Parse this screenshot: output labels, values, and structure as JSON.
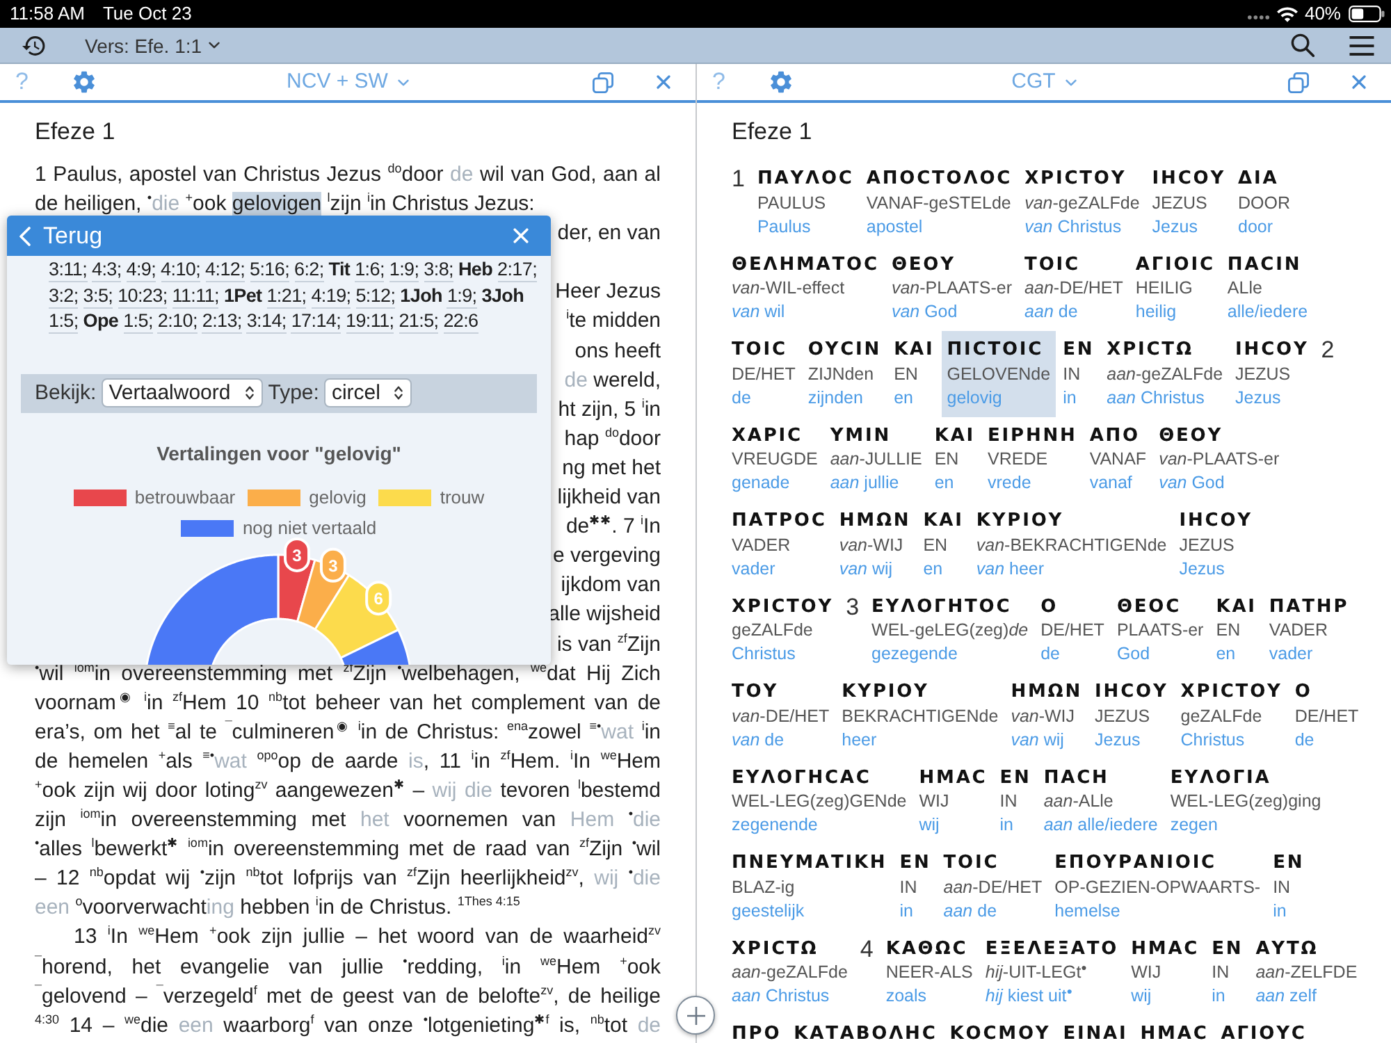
{
  "status_bar": {
    "time": "11:58 AM",
    "date": "Tue Oct 23",
    "battery": "40%"
  },
  "toolbar": {
    "verse_selector": "Vers: Efe. 1:1"
  },
  "panes": [
    {
      "kind": "text",
      "help": "?",
      "title": "NCV + SW",
      "heading": "Efeze 1",
      "lines": [
        {
          "kind": "justified",
          "segments": [
            {
              "kind": "plain",
              "text": "1 Paulus, apostel van Christus Jezus $^{do}$door "
            },
            {
              "kind": "muted",
              "text": "de"
            },
            {
              "kind": "plain",
              "text": " wil van God, aan al"
            }
          ]
        },
        {
          "kind": "end",
          "segments": [
            {
              "kind": "plain",
              "text": "de heiligen, $^{•}$"
            },
            {
              "kind": "muted",
              "text": "die"
            },
            {
              "kind": "plain",
              "text": " $^{+}$ook "
            },
            {
              "kind": "highlighted",
              "text": "gelovigen"
            },
            {
              "kind": "plain",
              "text": " $^{l}$zijn $^{i}$in Christus Jezus:"
            }
          ]
        },
        {
          "kind": "tail",
          "segments": [
            {
              "kind": "plain",
              "text": "der, en van"
            }
          ]
        },
        {
          "kind": "covered"
        },
        {
          "kind": "tail",
          "segments": [
            {
              "kind": "plain",
              "text": "Heer Jezus"
            }
          ]
        },
        {
          "kind": "tail",
          "segments": [
            {
              "kind": "plain",
              "text": "$^{i}$te midden"
            }
          ]
        },
        {
          "kind": "tail",
          "segments": [
            {
              "kind": "plain",
              "text": "ons heeft"
            }
          ]
        },
        {
          "kind": "tail",
          "segments": [
            {
              "kind": "muted",
              "text": "de"
            },
            {
              "kind": "plain",
              "text": " wereld,"
            }
          ]
        },
        {
          "kind": "tail",
          "segments": [
            {
              "kind": "plain",
              "text": "ht zijn, 5 $^{i}$in"
            }
          ]
        },
        {
          "kind": "tail",
          "segments": [
            {
              "kind": "plain",
              "text": "hap $^{do}$door"
            }
          ]
        },
        {
          "kind": "tail",
          "segments": [
            {
              "kind": "plain",
              "text": "ng met het"
            }
          ]
        },
        {
          "kind": "tail",
          "segments": [
            {
              "kind": "plain",
              "text": "lijkheid van"
            }
          ]
        },
        {
          "kind": "tail",
          "segments": [
            {
              "kind": "plain",
              "text": "de$^{✱✱}$. 7 $^{i}$In"
            }
          ]
        },
        {
          "kind": "tail",
          "segments": [
            {
              "kind": "plain",
              "text": "e vergeving"
            }
          ]
        },
        {
          "kind": "tail",
          "segments": [
            {
              "kind": "plain",
              "text": "ijkdom van"
            }
          ]
        },
        {
          "kind": "tail",
          "segments": [
            {
              "kind": "plain",
              "text": "alle wijsheid"
            }
          ]
        },
        {
          "kind": "tail",
          "segments": [
            {
              "kind": "plain",
              "text": "is van $^{zf}$Zijn"
            }
          ]
        },
        {
          "kind": "justified",
          "segments": [
            {
              "kind": "plain",
              "text": "$^{•}$wil $^{iom}$in overeenstemming met $^{zf}$Zijn $^{•}$welbehagen, $^{we}$dat Hij Zich"
            }
          ]
        },
        {
          "kind": "justified",
          "segments": [
            {
              "kind": "plain",
              "text": "voornam$^{◉}$ $^{i}$in $^{zf}$Hem 10 $^{nb}$tot beheer van het complement van de"
            }
          ]
        },
        {
          "kind": "justified",
          "segments": [
            {
              "kind": "plain",
              "text": "era’s, om het $^{≡}$al te $^{¯}$culmineren$^{◉}$ $^{i}$in de Christus: $^{ena}$zowel $^{≡•}$"
            },
            {
              "kind": "muted",
              "text": "wat"
            },
            {
              "kind": "plain",
              "text": " $^{i}$in"
            }
          ]
        },
        {
          "kind": "justified",
          "segments": [
            {
              "kind": "plain",
              "text": "de hemelen $^{+}$als $^{≡•}$"
            },
            {
              "kind": "muted",
              "text": "wat"
            },
            {
              "kind": "plain",
              "text": " $^{opo}$op de aarde "
            },
            {
              "kind": "muted",
              "text": "is"
            },
            {
              "kind": "plain",
              "text": ", 11 $^{i}$in $^{zf}$Hem. $^{i}$In $^{we}$Hem"
            }
          ]
        },
        {
          "kind": "justified",
          "segments": [
            {
              "kind": "plain",
              "text": "$^{+}$ook zijn wij door loting$^{zv}$ aangewezen$^{✱}$ – "
            },
            {
              "kind": "muted",
              "text": "wij die"
            },
            {
              "kind": "plain",
              "text": " tevoren $^{l}$bestemd"
            }
          ]
        },
        {
          "kind": "justified",
          "segments": [
            {
              "kind": "plain",
              "text": "zijn $^{iom}$in overeenstemming met "
            },
            {
              "kind": "muted",
              "text": "het"
            },
            {
              "kind": "plain",
              "text": " voornemen van "
            },
            {
              "kind": "muted",
              "text": "Hem"
            },
            {
              "kind": "plain",
              "text": " $^{•}$"
            },
            {
              "kind": "muted",
              "text": "die"
            }
          ]
        },
        {
          "kind": "justified",
          "segments": [
            {
              "kind": "plain",
              "text": "$^{•}$alles $^{l}$bewerkt$^{✱}$ $^{iom}$in overeenstemming met de raad van $^{zf}$Zijn $^{•}$wil"
            }
          ]
        },
        {
          "kind": "justified",
          "segments": [
            {
              "kind": "plain",
              "text": "– 12 $^{nb}$opdat wij $^{•}$zijn $^{nb}$tot lofprijs van $^{zf}$Zijn heerlijkheid$^{zv}$, "
            },
            {
              "kind": "muted",
              "text": "wij"
            },
            {
              "kind": "plain",
              "text": " $^{•}$"
            },
            {
              "kind": "muted",
              "text": "die"
            }
          ]
        },
        {
          "kind": "end",
          "segments": [
            {
              "kind": "muted",
              "text": "een"
            },
            {
              "kind": "plain",
              "text": " $^{o}$voorverwacht"
            },
            {
              "kind": "muted",
              "text": "ing"
            },
            {
              "kind": "plain",
              "text": " hebben $^{i}$in de Christus. $^{1Thes 4:15}$"
            }
          ]
        },
        {
          "kind": "indented",
          "segments": [
            {
              "kind": "plain",
              "text": "13 $^{i}$In $^{we}$Hem $^{+}$ook zijn jullie – het woord van de waarheid$^{zv}$"
            }
          ]
        },
        {
          "kind": "justified",
          "segments": [
            {
              "kind": "plain",
              "text": "$^{¯}$horend, het evangelie van jullie $^{•}$redding, $^{i}$in $^{we}$Hem $^{+}$ook"
            }
          ]
        },
        {
          "kind": "justified",
          "segments": [
            {
              "kind": "plain",
              "text": "$^{¯}$gelovend – $^{¯}$verzegeld$^{f}$ met de geest van de belofte$^{zv}$, de heilige"
            }
          ]
        },
        {
          "kind": "justified",
          "segments": [
            {
              "kind": "plain",
              "text": "$^{4:30}$ 14 – $^{we}$die "
            },
            {
              "kind": "muted",
              "text": "een"
            },
            {
              "kind": "plain",
              "text": " waarborg$^{f}$ van onze $^{•}$lotgenieting$^{✱f}$ is, $^{nb}$tot "
            },
            {
              "kind": "muted",
              "text": "de"
            }
          ]
        }
      ]
    },
    {
      "kind": "interlinear",
      "help": "?",
      "title": "CGT",
      "heading": "Efeze 1",
      "rows": [
        {
          "items": [
            {
              "kind": "verse",
              "number": "1"
            },
            {
              "kind": "word",
              "greek": "ΠΑΥΛΟϹ",
              "gloss": "PAULUS",
              "translation": "Paulus",
              "selected": false
            },
            {
              "kind": "word",
              "greek": "ΑΠΟϹΤΟΛΟϹ",
              "gloss": "VANAF-geSTELde",
              "translation": "apostel",
              "selected": false
            },
            {
              "kind": "word",
              "greek": "ΧΡΙϹΤΟΥ",
              "gloss": "*van*-geZALFde",
              "translation": "*van* Christus",
              "selected": false
            },
            {
              "kind": "word",
              "greek": "ΙΗϹΟΥ",
              "gloss": "JEZUS",
              "translation": "Jezus",
              "selected": false
            },
            {
              "kind": "word",
              "greek": "ΔΙΑ",
              "gloss": "DOOR",
              "translation": "door",
              "selected": false
            }
          ]
        },
        {
          "items": [
            {
              "kind": "word",
              "greek": "ΘΕΛΗΜΑΤΟϹ",
              "gloss": "*van*-WIL-effect",
              "translation": "*van* wil",
              "selected": false
            },
            {
              "kind": "word",
              "greek": "ΘΕΟΥ",
              "gloss": "*van*-PLAATS-er",
              "translation": "*van* God",
              "selected": false
            },
            {
              "kind": "word",
              "greek": "ΤΟΙϹ",
              "gloss": "*aan*-DE/HET",
              "translation": "*aan* de",
              "selected": false
            },
            {
              "kind": "word",
              "greek": "ΑΓΙΟΙϹ",
              "gloss": "HEILIG",
              "translation": "heilig",
              "selected": false
            },
            {
              "kind": "word",
              "greek": "ΠΑϹΙΝ",
              "gloss": "ALle",
              "translation": "alle/iedere",
              "selected": false
            }
          ]
        },
        {
          "items": [
            {
              "kind": "word",
              "greek": "ΤΟΙϹ",
              "gloss": "DE/HET",
              "translation": "de",
              "selected": false
            },
            {
              "kind": "word",
              "greek": "ΟΥϹΙΝ",
              "gloss": "ZIJNden",
              "translation": "zijnden",
              "selected": false
            },
            {
              "kind": "word",
              "greek": "ΚΑΙ",
              "gloss": "EN",
              "translation": "en",
              "selected": false
            },
            {
              "kind": "word",
              "greek": "ΠΙϹΤΟΙϹ",
              "gloss": "GELOVENde",
              "translation": "gelovig",
              "selected": true
            },
            {
              "kind": "word",
              "greek": "ΕΝ",
              "gloss": "IN",
              "translation": "in",
              "selected": false
            },
            {
              "kind": "word",
              "greek": "ΧΡΙϹΤΩ",
              "gloss": "*aan*-geZALFde",
              "translation": "*aan* Christus",
              "selected": false
            },
            {
              "kind": "word",
              "greek": "ΙΗϹΟΥ",
              "gloss": "JEZUS",
              "translation": "Jezus",
              "selected": false
            },
            {
              "kind": "verse",
              "number": "2"
            }
          ]
        },
        {
          "items": [
            {
              "kind": "word",
              "greek": "ΧΑΡΙϹ",
              "gloss": "VREUGDE",
              "translation": "genade",
              "selected": false
            },
            {
              "kind": "word",
              "greek": "ΥΜΙΝ",
              "gloss": "*aan*-JULLIE",
              "translation": "*aan* jullie",
              "selected": false
            },
            {
              "kind": "word",
              "greek": "ΚΑΙ",
              "gloss": "EN",
              "translation": "en",
              "selected": false
            },
            {
              "kind": "word",
              "greek": "ΕΙΡΗΝΗ",
              "gloss": "VREDE",
              "translation": "vrede",
              "selected": false
            },
            {
              "kind": "word",
              "greek": "ΑΠΟ",
              "gloss": "VANAF",
              "translation": "vanaf",
              "selected": false
            },
            {
              "kind": "word",
              "greek": "ΘΕΟΥ",
              "gloss": "*van*-PLAATS-er",
              "translation": "*van* God",
              "selected": false
            }
          ]
        },
        {
          "items": [
            {
              "kind": "word",
              "greek": "ΠΑΤΡΟϹ",
              "gloss": "VADER",
              "translation": "vader",
              "selected": false
            },
            {
              "kind": "word",
              "greek": "ΗΜΩΝ",
              "gloss": "*van*-WIJ",
              "translation": "*van* wij",
              "selected": false
            },
            {
              "kind": "word",
              "greek": "ΚΑΙ",
              "gloss": "EN",
              "translation": "en",
              "selected": false
            },
            {
              "kind": "word",
              "greek": "ΚΥΡΙΟΥ",
              "gloss": "*van*-BEKRACHTIGENde",
              "translation": "*van* heer",
              "selected": false
            },
            {
              "kind": "word",
              "greek": "ΙΗϹΟΥ",
              "gloss": "JEZUS",
              "translation": "Jezus",
              "selected": false
            }
          ]
        },
        {
          "items": [
            {
              "kind": "word",
              "greek": "ΧΡΙϹΤΟΥ",
              "gloss": "geZALFde",
              "translation": "Christus",
              "selected": false
            },
            {
              "kind": "verse",
              "number": "3"
            },
            {
              "kind": "word",
              "greek": "ΕΥΛΟΓΗΤΟϹ",
              "gloss": "WEL-geLEG(zeg)*de*",
              "translation": "gezegende",
              "selected": false
            },
            {
              "kind": "word",
              "greek": "Ο",
              "gloss": "DE/HET",
              "translation": "de",
              "selected": false
            },
            {
              "kind": "word",
              "greek": "ΘΕΟϹ",
              "gloss": "PLAATS-er",
              "translation": "God",
              "selected": false
            },
            {
              "kind": "word",
              "greek": "ΚΑΙ",
              "gloss": "EN",
              "translation": "en",
              "selected": false
            },
            {
              "kind": "word",
              "greek": "ΠΑΤΗΡ",
              "gloss": "VADER",
              "translation": "vader",
              "selected": false
            }
          ]
        },
        {
          "items": [
            {
              "kind": "word",
              "greek": "ΤΟΥ",
              "gloss": "*van*-DE/HET",
              "translation": "*van* de",
              "selected": false
            },
            {
              "kind": "word",
              "greek": "ΚΥΡΙΟΥ",
              "gloss": "BEKRACHTIGENde",
              "translation": "heer",
              "selected": false
            },
            {
              "kind": "word",
              "greek": "ΗΜΩΝ",
              "gloss": "*van*-WIJ",
              "translation": "*van* wij",
              "selected": false
            },
            {
              "kind": "word",
              "greek": "ΙΗϹΟΥ",
              "gloss": "JEZUS",
              "translation": "Jezus",
              "selected": false
            },
            {
              "kind": "word",
              "greek": "ΧΡΙϹΤΟΥ",
              "gloss": "geZALFde",
              "translation": "Christus",
              "selected": false
            },
            {
              "kind": "word",
              "greek": "Ο",
              "gloss": "DE/HET",
              "translation": "de",
              "selected": false
            }
          ]
        },
        {
          "items": [
            {
              "kind": "word",
              "greek": "ΕΥΛΟΓΗϹΑϹ",
              "gloss": "WEL-LEG(zeg)GENde",
              "translation": "zegenende",
              "selected": false
            },
            {
              "kind": "word",
              "greek": "ΗΜΑϹ",
              "gloss": "WIJ",
              "translation": "wij",
              "selected": false
            },
            {
              "kind": "word",
              "greek": "ΕΝ",
              "gloss": "IN",
              "translation": "in",
              "selected": false
            },
            {
              "kind": "word",
              "greek": "ΠΑϹΗ",
              "gloss": "*aan*-ALle",
              "translation": "*aan* alle/iedere",
              "selected": false
            },
            {
              "kind": "word",
              "greek": "ΕΥΛΟΓΙΑ",
              "gloss": "WEL-LEG(zeg)ging",
              "translation": "zegen",
              "selected": false
            }
          ]
        },
        {
          "items": [
            {
              "kind": "word",
              "greek": "ΠΝΕΥΜΑΤΙΚΗ",
              "gloss": "BLAZ-ig",
              "translation": "geestelijk",
              "selected": false
            },
            {
              "kind": "word",
              "greek": "ΕΝ",
              "gloss": "IN",
              "translation": "in",
              "selected": false
            },
            {
              "kind": "word",
              "greek": "ΤΟΙϹ",
              "gloss": "*aan*-DE/HET",
              "translation": "*aan* de",
              "selected": false
            },
            {
              "kind": "word",
              "greek": "ΕΠΟΥΡΑΝΙΟΙϹ",
              "gloss": "OP-GEZIEN-OPWAARTS-",
              "translation": "hemelse",
              "selected": false
            },
            {
              "kind": "word",
              "greek": "ΕΝ",
              "gloss": "IN",
              "translation": "in",
              "selected": false
            }
          ]
        },
        {
          "items": [
            {
              "kind": "word",
              "greek": "ΧΡΙϹΤΩ",
              "gloss": "*aan*-geZALFde",
              "translation": "*aan* Christus",
              "selected": false
            },
            {
              "kind": "verse",
              "number": "4"
            },
            {
              "kind": "word",
              "greek": "ΚΑΘΩϹ",
              "gloss": "NEER-ALS",
              "translation": "zoals",
              "selected": false
            },
            {
              "kind": "word",
              "greek": "ΕΞΕΛΕΞΑΤΟ",
              "gloss": "*hij*-UIT-LEGt$^{●}$",
              "translation": "*hij* kiest uit$^{●}$",
              "selected": false
            },
            {
              "kind": "word",
              "greek": "ΗΜΑϹ",
              "gloss": "WIJ",
              "translation": "wij",
              "selected": false
            },
            {
              "kind": "word",
              "greek": "ΕΝ",
              "gloss": "IN",
              "translation": "in",
              "selected": false
            },
            {
              "kind": "word",
              "greek": "ΑΥΤΩ",
              "gloss": "*aan*-ZELFDE",
              "translation": "*aan* zelf",
              "selected": false
            }
          ]
        },
        {
          "items": [
            {
              "kind": "word",
              "greek": "ΠΡΟ",
              "selected": false
            },
            {
              "kind": "word",
              "greek": "ΚΑΤΑΒΟΛΗϹ",
              "selected": false
            },
            {
              "kind": "word",
              "greek": "ΚΟϹΜΟΥ",
              "selected": false
            },
            {
              "kind": "word",
              "greek": "ΕΙΝΑΙ",
              "selected": false
            },
            {
              "kind": "word",
              "greek": "ΗΜΑϹ",
              "selected": false
            },
            {
              "kind": "word",
              "greek": "ΑΓΙΟΥϹ",
              "selected": false
            }
          ]
        }
      ]
    }
  ],
  "popup": {
    "back": "Terug",
    "references": [
      {
        "kind": "ref",
        "text": "3:11;"
      },
      {
        "kind": "ref",
        "text": "4:3;"
      },
      {
        "kind": "ref",
        "text": "4:9;"
      },
      {
        "kind": "ref",
        "text": "4:10;"
      },
      {
        "kind": "ref",
        "text": "4:12;"
      },
      {
        "kind": "ref",
        "text": "5:16;"
      },
      {
        "kind": "ref",
        "text": "6:2;"
      },
      {
        "kind": "book",
        "text": "Tit"
      },
      {
        "kind": "ref",
        "text": "1:6;"
      },
      {
        "kind": "ref",
        "text": "1:9;"
      },
      {
        "kind": "ref",
        "text": "3:8;"
      },
      {
        "kind": "book",
        "text": "Heb"
      },
      {
        "kind": "ref",
        "text": "2:17;"
      },
      {
        "kind": "ref",
        "text": "3:2;"
      },
      {
        "kind": "ref",
        "text": "3:5;"
      },
      {
        "kind": "ref",
        "text": "10:23;"
      },
      {
        "kind": "ref",
        "text": "11:11;"
      },
      {
        "kind": "book",
        "text": "1Pet"
      },
      {
        "kind": "ref",
        "text": "1:21;"
      },
      {
        "kind": "ref",
        "text": "4:19;"
      },
      {
        "kind": "ref",
        "text": "5:12;"
      },
      {
        "kind": "book",
        "text": "1Joh"
      },
      {
        "kind": "ref",
        "text": "1:9;"
      },
      {
        "kind": "book",
        "text": "3Joh"
      },
      {
        "kind": "ref",
        "text": "1:5;"
      },
      {
        "kind": "book",
        "text": "Ope"
      },
      {
        "kind": "ref",
        "text": "1:5;"
      },
      {
        "kind": "ref",
        "text": "2:10;"
      },
      {
        "kind": "ref",
        "text": "2:13;"
      },
      {
        "kind": "ref",
        "text": "3:14;"
      },
      {
        "kind": "ref",
        "text": "17:14;"
      },
      {
        "kind": "ref",
        "text": "19:11;"
      },
      {
        "kind": "ref",
        "text": "21:5;"
      },
      {
        "kind": "ref",
        "text": "22:6"
      }
    ],
    "view_label": "Bekijk:",
    "view_value": "Vertaalwoord",
    "type_label": "Type:",
    "type_value": "circel",
    "chart": {
      "title": "Vertalingen voor \"gelovig\"",
      "series": [
        {
          "name": "betrouwbaar",
          "color": "#e8474c",
          "label": "3"
        },
        {
          "name": "gelovig",
          "color": "#fbae4a",
          "label": "3"
        },
        {
          "name": "trouw",
          "color": "#fcdb4c",
          "label": "6"
        },
        {
          "name": "nog niet vertaald",
          "color": "#4a78f6"
        }
      ]
    }
  }
}
